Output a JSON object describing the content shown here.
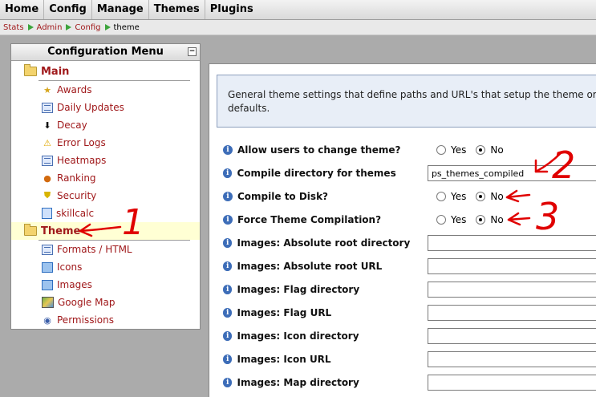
{
  "topnav": {
    "items": [
      "Home",
      "Config",
      "Manage",
      "Themes",
      "Plugins"
    ]
  },
  "breadcrumb": {
    "items": [
      "Stats",
      "Admin",
      "Config"
    ],
    "current": "theme"
  },
  "config_menu": {
    "title": "Configuration Menu",
    "collapse_label": "−",
    "main_group": "Main",
    "main_items": [
      {
        "label": "Awards",
        "icon": "award-icon"
      },
      {
        "label": "Daily Updates",
        "icon": "list-icon"
      },
      {
        "label": "Decay",
        "icon": "decay-arrow-icon"
      },
      {
        "label": "Error Logs",
        "icon": "warning-icon"
      },
      {
        "label": "Heatmaps",
        "icon": "list-icon"
      },
      {
        "label": "Ranking",
        "icon": "medal-icon"
      },
      {
        "label": "Security",
        "icon": "shield-icon"
      },
      {
        "label": "skillcalc",
        "icon": "calculator-icon"
      }
    ],
    "theme_group": "Theme",
    "theme_items": [
      {
        "label": "Formats / HTML",
        "icon": "list-icon"
      },
      {
        "label": "Icons",
        "icon": "image-icon"
      },
      {
        "label": "Images",
        "icon": "image-icon"
      },
      {
        "label": "Google Map",
        "icon": "map-icon"
      },
      {
        "label": "Permissions",
        "icon": "eye-icon"
      }
    ]
  },
  "content": {
    "description_line1": "General theme settings that define paths and URL's that setup the theme or",
    "description_line2": "defaults.",
    "settings": [
      {
        "label": "Allow users to change theme?",
        "type": "radio",
        "yes": "Yes",
        "no": "No",
        "value": "No"
      },
      {
        "label": "Compile directory for themes",
        "type": "text",
        "value": "ps_themes_compiled"
      },
      {
        "label": "Compile to Disk?",
        "type": "radio",
        "yes": "Yes",
        "no": "No",
        "value": "No"
      },
      {
        "label": "Force Theme Compilation?",
        "type": "radio",
        "yes": "Yes",
        "no": "No",
        "value": "No"
      },
      {
        "label": "Images: Absolute root directory",
        "type": "text",
        "value": ""
      },
      {
        "label": "Images: Absolute root URL",
        "type": "text",
        "value": ""
      },
      {
        "label": "Images: Flag directory",
        "type": "text",
        "value": ""
      },
      {
        "label": "Images: Flag URL",
        "type": "text",
        "value": ""
      },
      {
        "label": "Images: Icon directory",
        "type": "text",
        "value": ""
      },
      {
        "label": "Images: Icon URL",
        "type": "text",
        "value": ""
      },
      {
        "label": "Images: Map directory",
        "type": "text",
        "value": ""
      }
    ]
  },
  "annotations": {
    "note1": "1",
    "note2": "2",
    "note3": "3",
    "color": "#e00000"
  },
  "colors": {
    "link": "#a0191b",
    "selected_row": "#ffffd4",
    "description_bg": "#e8eef7",
    "crumb_arrow": "#3ca43c"
  }
}
